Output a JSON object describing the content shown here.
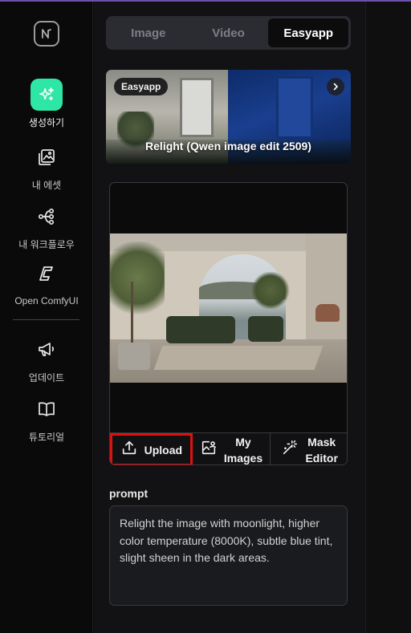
{
  "sidebar": {
    "items": [
      {
        "label": "생성하기",
        "icon": "sparkles-icon"
      },
      {
        "label": "내 에셋",
        "icon": "image-gallery-icon"
      },
      {
        "label": "내 워크플로우",
        "icon": "workflow-icon"
      },
      {
        "label": "Open ComfyUI",
        "icon": "comfyui-icon"
      },
      {
        "label": "업데이트",
        "icon": "megaphone-icon"
      },
      {
        "label": "튜토리얼",
        "icon": "book-icon"
      }
    ]
  },
  "tabs": [
    {
      "label": "Image",
      "active": false
    },
    {
      "label": "Video",
      "active": false
    },
    {
      "label": "Easyapp",
      "active": true
    }
  ],
  "banner": {
    "badge": "Easyapp",
    "title": "Relight (Qwen image edit 2509)"
  },
  "actions": {
    "upload": "Upload",
    "my_images_line1": "My",
    "my_images_line2": "Images",
    "mask_editor_line1": "Mask",
    "mask_editor_line2": "Editor"
  },
  "prompt": {
    "label": "prompt",
    "value": "Relight the image with moonlight, higher color temperature (8000K), subtle blue tint, slight sheen in the dark areas."
  },
  "colors": {
    "accent": "#2ee6a6",
    "highlight": "#e01010"
  }
}
